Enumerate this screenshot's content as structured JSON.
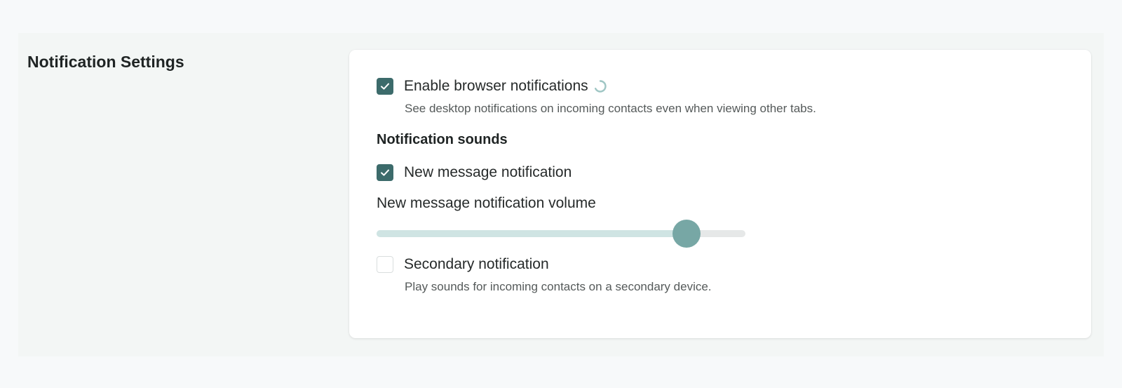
{
  "section": {
    "title": "Notification Settings"
  },
  "browser_notifications": {
    "label": "Enable browser notifications",
    "checked": true,
    "loading_icon": "spinner-icon",
    "help": "See desktop notifications on incoming contacts even when viewing other tabs."
  },
  "sounds": {
    "heading": "Notification sounds",
    "new_message": {
      "label": "New message notification",
      "checked": true
    },
    "volume": {
      "label": "New message notification volume",
      "value_fraction": 0.84
    },
    "secondary": {
      "label": "Secondary notification",
      "checked": false,
      "help": "Play sounds for incoming contacts on a secondary device."
    }
  },
  "colors": {
    "accent": "#3c6b6b",
    "slider_thumb": "#77a7a5",
    "slider_fill": "#cfe4e3",
    "slider_track": "#e6e8e8",
    "background": "#f7f9fa",
    "section_background": "#f3f6f5"
  }
}
